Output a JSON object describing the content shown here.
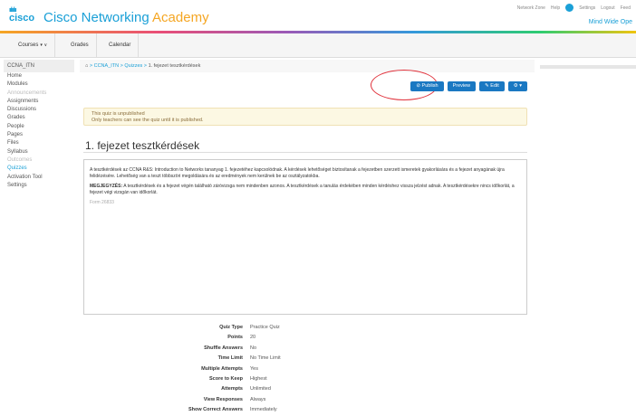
{
  "header": {
    "logo_text": "cisco",
    "brand_prefix": "Cisco Networking ",
    "brand_suffix": "Academy",
    "top_links": [
      "Network Zone",
      "Help",
      "Settings",
      "Logout",
      "Feed"
    ],
    "mind_wide": "Mind Wide Ope"
  },
  "nav": {
    "courses": "Courses",
    "grades": "Grades",
    "calendar": "Calendar"
  },
  "sidebar": {
    "course": "CCNA_ITN",
    "items": [
      {
        "label": "Home",
        "state": "normal"
      },
      {
        "label": "Modules",
        "state": "normal"
      },
      {
        "label": "Announcements",
        "state": "muted"
      },
      {
        "label": "Assignments",
        "state": "normal"
      },
      {
        "label": "Discussions",
        "state": "normal"
      },
      {
        "label": "Grades",
        "state": "normal"
      },
      {
        "label": "People",
        "state": "normal"
      },
      {
        "label": "Pages",
        "state": "normal"
      },
      {
        "label": "Files",
        "state": "normal"
      },
      {
        "label": "Syllabus",
        "state": "normal"
      },
      {
        "label": "Outcomes",
        "state": "muted"
      },
      {
        "label": "Quizzes",
        "state": "active"
      },
      {
        "label": "Activation Tool",
        "state": "normal"
      },
      {
        "label": "Settings",
        "state": "normal"
      }
    ]
  },
  "breadcrumb": {
    "course": "CCNA_ITN",
    "section": "Quizzes",
    "page": "1. fejezet tesztkérdések"
  },
  "toolbar": {
    "publish": "Publish",
    "preview": "Preview",
    "edit": "Edit",
    "more": "⚙"
  },
  "notice": {
    "line1": "This quiz is unpublished",
    "line2": "Only teachers can see the quiz until it is published."
  },
  "quiz": {
    "title": "1. fejezet tesztkérdések",
    "paragraph1": "A tesztkérdések az CCNA R&S: Introduction to Networks tananyag 1. fejezetéhez kapcsolódnak. A kérdések lehetőséget biztosítanak a fejezetben szerzett ismeretek gyakorlására és a fejezet anyagának újra felidézésére. Lehetőség van a teszt többszöri megoldására és az eredmények nem kerülnek be az osztályzatokba.",
    "paragraph2_strong": "MEGJEGYZÉS:",
    "paragraph2": " A tesztkérdések és a fejezet végén található záróvizsga nem mindenben azonos. A tesztkérdések a tanulás érdekében minden kérdéshez vissza jelzést adnak. A tesztkérdésekre nincs időkorlát, a fejezet végi vizsgán van időkorlát.",
    "form_id": "Form 26833"
  },
  "properties": [
    {
      "label": "Quiz Type",
      "value": "Practice Quiz"
    },
    {
      "label": "Points",
      "value": "20"
    },
    {
      "label": "Shuffle Answers",
      "value": "No"
    },
    {
      "label": "Time Limit",
      "value": "No Time Limit"
    },
    {
      "label": "Multiple Attempts",
      "value": "Yes"
    },
    {
      "label": "Score to Keep",
      "value": "Highest"
    },
    {
      "label": "Attempts",
      "value": "Unlimited"
    },
    {
      "label": "View Responses",
      "value": "Always"
    },
    {
      "label": "Show Correct Answers",
      "value": "Immediately"
    }
  ]
}
